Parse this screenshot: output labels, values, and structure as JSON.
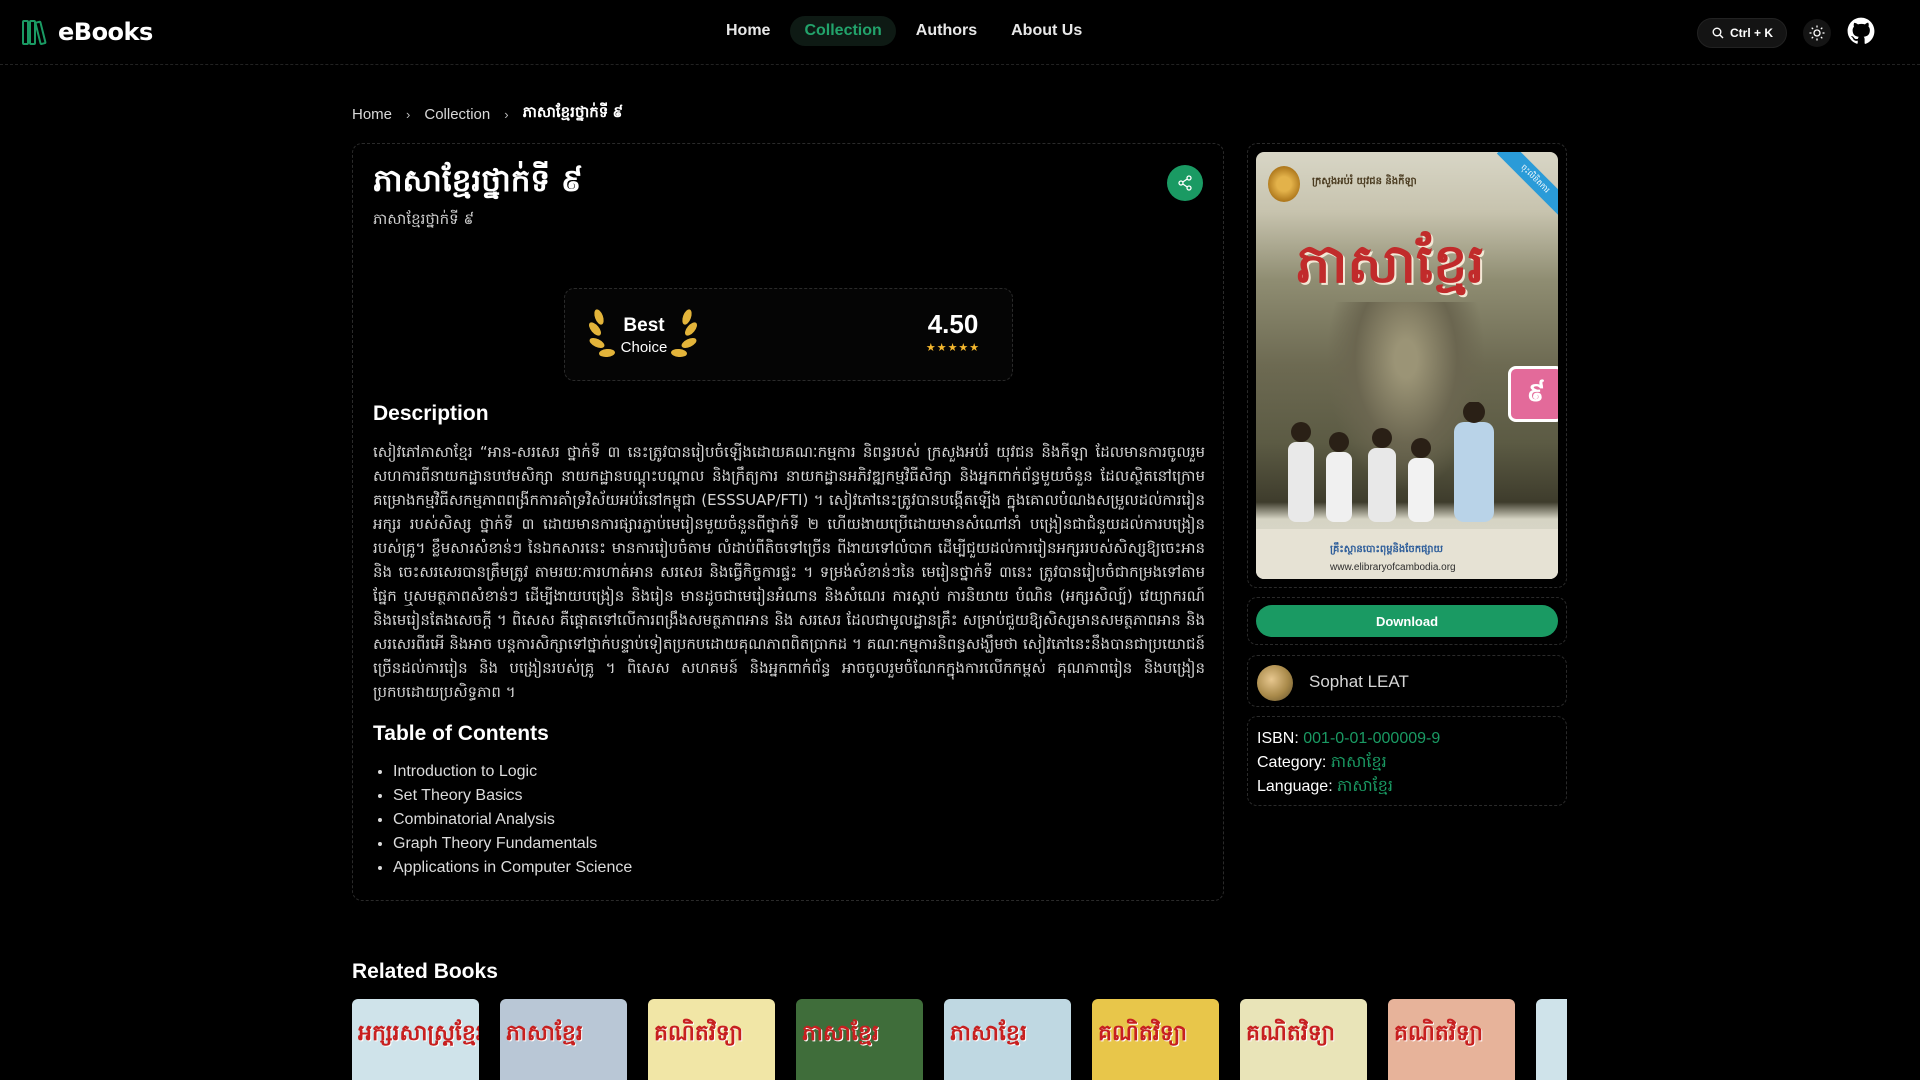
{
  "header": {
    "logo_text": "eBooks",
    "nav": [
      {
        "label": "Home",
        "active": false
      },
      {
        "label": "Collection",
        "active": true
      },
      {
        "label": "Authors",
        "active": false
      },
      {
        "label": "About Us",
        "active": false
      }
    ],
    "search_shortcut": "Ctrl + K",
    "icons": [
      "library-logo-icon",
      "search-icon",
      "sun-icon",
      "github-icon"
    ]
  },
  "breadcrumb": {
    "items": [
      "Home",
      "Collection",
      "ភាសាខ្មែរថ្នាក់ទី ៩"
    ]
  },
  "book": {
    "title": "ភាសាខ្មែរថ្នាក់ទី ៩",
    "subtitle": "ភាសាខ្មែរថ្នាក់ទី ៩",
    "badge_line1": "Best",
    "badge_line2": "Choice",
    "rating": "4.50",
    "stars": "★★★★★",
    "description_heading": "Description",
    "description": "សៀវភៅភាសាខ្មែរ “អាន-សរសេរ ថ្នាក់ទី ៣ នេះត្រូវបានរៀបចំឡើងដោយគណៈកម្មការ និពន្ធរបស់ ក្រសួងអប់រំ យុវជន និងកីឡា ដែលមានការចូលរួមសហការពីនាយកដ្ឋានបឋមសិក្សា នាយកដ្ឋានបណ្តុះបណ្តាល និងក្រឹត្យការ នាយកដ្ឋានអភិវឌ្ឍកម្មវិធីសិក្សា និងអ្នកពាក់ព័ន្ធមួយចំនួន ដែលស្ថិតនៅក្រោមគម្រោងកម្មវិធីសកម្មភាពពង្រីកការគាំទ្រវិស័យអប់រំនៅកម្ពុជា (ESSSUAP/FTI) ។ សៀវភៅនេះត្រូវបានបង្កើតឡើង ក្នុងគោលបំណងសម្រួលដល់ការរៀនអក្សរ របស់សិស្ស ថ្នាក់ទី ៣ ដោយមានការផ្សារភ្ជាប់មេរៀនមួយចំនួនពីថ្នាក់ទី ២ ហើយងាយប្រើដោយមានសំណៅនាំ បង្រៀនជាជំនួយដល់ការបង្រៀនរបស់គ្រូ។ ខ្លឹមសារសំខាន់ៗ នៃឯកសារនេះ មានការរៀបចំតាម លំដាប់ពីតិចទៅច្រើន ពីងាយទៅលំបាក ដើម្បីជួយដល់ការរៀនអក្សររបស់សិស្សឱ្យចេះអាន និង ចេះសរសេរបានត្រឹមត្រូវ តាមរយៈការហាត់អាន សរសេរ និងធ្វើកិច្ចការផ្ទះ ។ ទម្រង់សំខាន់ៗនៃ មេរៀនថ្នាក់ទី ៣នេះ ត្រូវបានរៀបចំជាកម្រងទៅតាមផ្នែក ឬសមត្ថភាពសំខាន់ៗ ដើម្បីងាយបង្រៀន និងរៀន មានដូចជាមេរៀនអំណាន និងសំណេរ ការស្តាប់ ការនិយាយ បំណិន (អក្សរសិល្ប៍) វេយ្យាករណ៍ និងមេរៀនតែងសេចក្តី ។ ពិសេស គឺផ្តោតទៅលើការពង្រឹងសមត្ថភាពអាន និង សរសេរ ដែលជាមូលដ្ឋានគ្រឹះ សម្រាប់ជួយឱ្យសិស្សមានសមត្ថភាពអាន និងសរសេរពីរអើ និងអាច បន្តការសិក្សាទៅថ្នាក់បន្ទាប់ទៀតប្រកបដោយគុណភាពពិតប្រាកដ ។ គណៈកម្មការនិពន្ធសង្ឃឹមថា សៀវភៅនេះនឹងបានជាប្រយោជន៍ច្រើនដល់ការរៀន និង បង្រៀនរបស់គ្រូ ។ ពិសេស សហគមន៍ និងអ្នកពាក់ព័ន្ធ អាចចូលរួមចំណែកក្នុងការលើកកម្ពស់ គុណភាពរៀន និងបង្រៀនប្រកបដោយប្រសិទ្ធភាព ។",
    "toc_heading": "Table of Contents",
    "toc": [
      "Introduction to Logic",
      "Set Theory Basics",
      "Combinatorial Analysis",
      "Graph Theory Fundamentals",
      "Applications in Computer Science"
    ]
  },
  "cover": {
    "header_text": "ក្រសួងអប់រំ យុវជន និងកីឡា",
    "title": "ភាសាខ្មែរ",
    "ribbon": "ចុះលិខិតការ",
    "grade": "៩",
    "publisher": "គ្រឹះស្ថានបោះពុម្ពនិងចែកផ្សាយ",
    "url": "www.elibraryofcambodia.org"
  },
  "sidebar": {
    "download_label": "Download",
    "author_name": "Sophat LEAT",
    "isbn_label": "ISBN:",
    "isbn_value": "001-0-01-000009-9",
    "category_label": "Category:",
    "category_value": "ភាសាខ្មែរ",
    "language_label": "Language:",
    "language_value": "ភាសាខ្មែរ"
  },
  "related": {
    "heading": "Related Books",
    "books": [
      {
        "title": "អក្សរសាស្ត្រខ្មែរ",
        "bg": "#cfe3ea"
      },
      {
        "title": "ភាសាខ្មែរ",
        "bg": "#b9c7d6"
      },
      {
        "title": "គណិតវិទ្យា",
        "bg": "#f1e6a6"
      },
      {
        "title": "ភាសាខ្មែរ",
        "bg": "#3f6d3a"
      },
      {
        "title": "ភាសាខ្មែរ",
        "bg": "#bfd8e2"
      },
      {
        "title": "គណិតវិទ្យា",
        "bg": "#e8c64a"
      },
      {
        "title": "គណិតវិទ្យា",
        "bg": "#e9e4b8"
      },
      {
        "title": "គណិតវិទ្យា",
        "bg": "#e7b39a"
      },
      {
        "title": "",
        "bg": "#cfe3ea"
      }
    ]
  },
  "colors": {
    "accent": "#1a9a63",
    "background": "#000000",
    "star": "#f5b82e"
  }
}
